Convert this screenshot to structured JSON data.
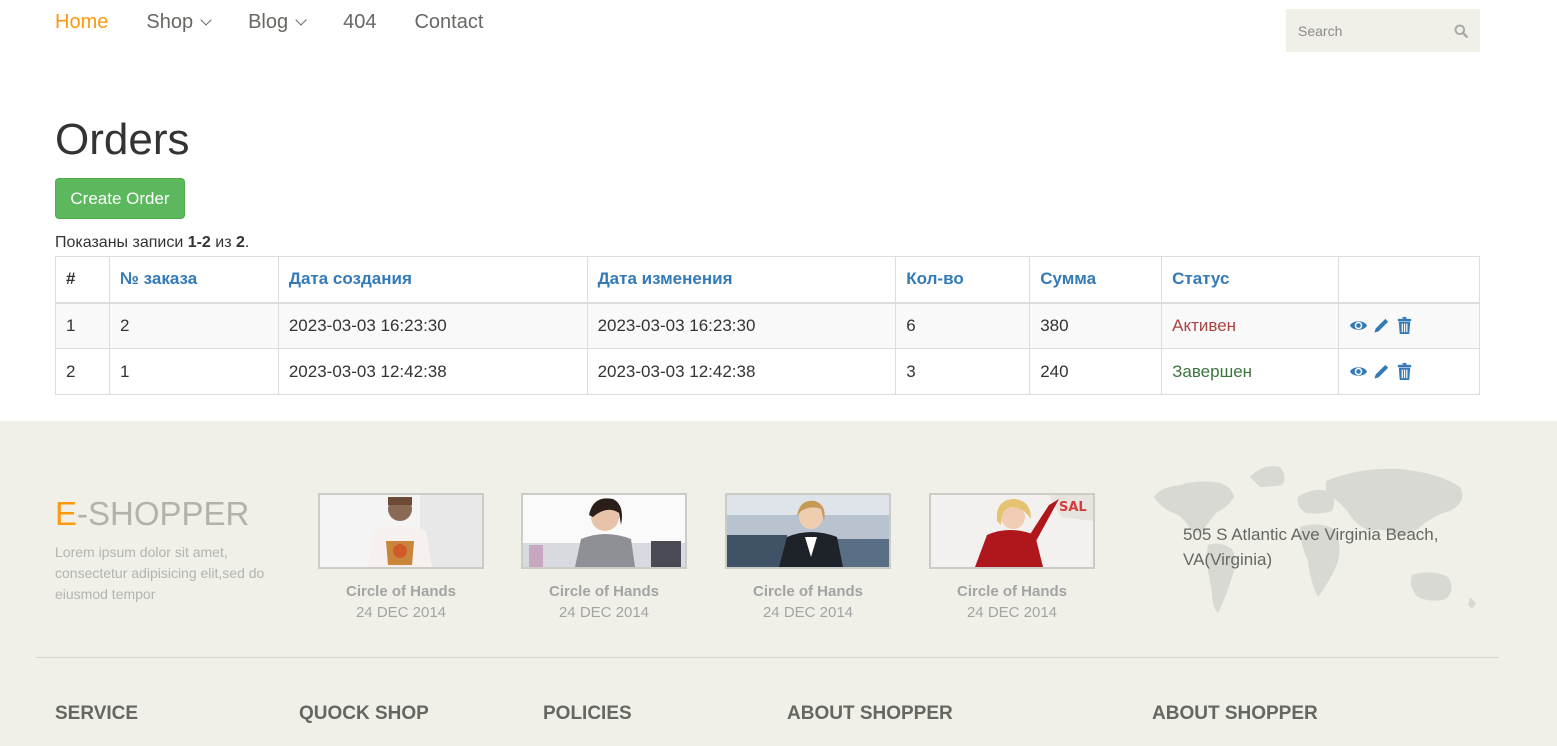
{
  "nav": {
    "items": [
      {
        "label": "Home",
        "active": true
      },
      {
        "label": "Shop",
        "dropdown": true
      },
      {
        "label": "Blog",
        "dropdown": true
      },
      {
        "label": "404"
      },
      {
        "label": "Contact"
      }
    ],
    "search_placeholder": "Search"
  },
  "main": {
    "title": "Orders",
    "create_button": "Create Order",
    "summary": {
      "prefix": "Показаны записи ",
      "range": "1-2",
      "middle": " из ",
      "total": "2",
      "suffix": "."
    },
    "table": {
      "headers": [
        "#",
        "№ заказа",
        "Дата создания",
        "Дата изменения",
        "Кол-во",
        "Сумма",
        "Статус",
        ""
      ],
      "rows": [
        {
          "index": "1",
          "order_no": "2",
          "created": "2023-03-03 16:23:30",
          "updated": "2023-03-03 16:23:30",
          "qty": "6",
          "sum": "380",
          "status": "Активен"
        },
        {
          "index": "2",
          "order_no": "1",
          "created": "2023-03-03 12:42:38",
          "updated": "2023-03-03 12:42:38",
          "qty": "3",
          "sum": "240",
          "status": "Завершен"
        }
      ]
    }
  },
  "footer": {
    "brand_e": "E",
    "brand_rest": "-SHOPPER",
    "brand_text": "Lorem ipsum dolor sit amet, consectetur adipisicing elit,sed do eiusmod tempor",
    "videos": [
      {
        "caption": "Circle of Hands",
        "date": "24 DEC 2014"
      },
      {
        "caption": "Circle of Hands",
        "date": "24 DEC 2014"
      },
      {
        "caption": "Circle of Hands",
        "date": "24 DEC 2014"
      },
      {
        "caption": "Circle of Hands",
        "date": "24 DEC 2014"
      }
    ],
    "address": "505 S Atlantic Ave Virginia Beach, VA(Virginia)",
    "columns": [
      "SERVICE",
      "QUOCK SHOP",
      "POLICIES",
      "ABOUT SHOPPER",
      "ABOUT SHOPPER"
    ]
  },
  "colors": {
    "accent": "#FE980F",
    "success": "#5CB85C",
    "link": "#337ab7",
    "active_status": "#a94442",
    "done_status": "#3c763d",
    "footer_bg": "#F0F0E9"
  }
}
